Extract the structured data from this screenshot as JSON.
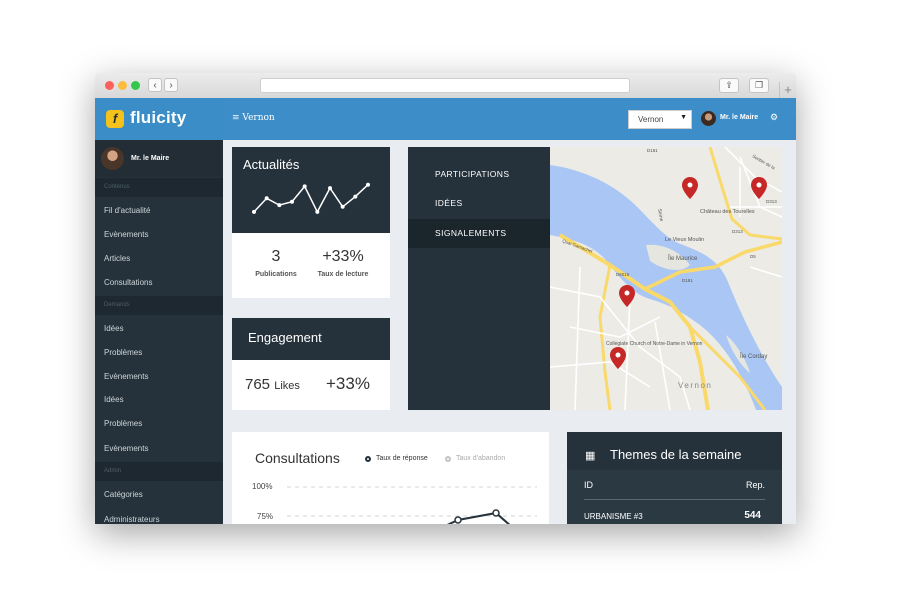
{
  "header": {
    "logo_text": "fluicity",
    "menu_label": "≡ Vernon",
    "city_select_value": "Vernon",
    "user_name": "Mr. le Maire"
  },
  "sidebar": {
    "profile_name": "Mr. le Maire",
    "sections": [
      {
        "title": "Contenus",
        "items": [
          "Fil d'actualité",
          "Evènements",
          "Articles",
          "Consultations"
        ]
      },
      {
        "title": "Demands",
        "items": [
          "Idées",
          "Problèmes",
          "Evènements",
          "Idées",
          "Problèmes",
          "Evènements"
        ]
      },
      {
        "title": "Admin",
        "items": [
          "Catégories",
          "Administrateurs"
        ]
      }
    ]
  },
  "actualites": {
    "title": "Actualités",
    "stats": [
      {
        "value": "3",
        "label": "Publications"
      },
      {
        "value": "+33%",
        "label": "Taux de lecture"
      }
    ],
    "sparkline": [
      0.15,
      0.55,
      0.35,
      0.45,
      0.9,
      0.15,
      0.85,
      0.3,
      0.6,
      0.95
    ]
  },
  "engagement": {
    "title": "Engagement",
    "likes_value": "765",
    "likes_unit": "Likes",
    "rate": "+33%"
  },
  "map_panel": {
    "menu": [
      "PARTICIPATIONS",
      "IDÉES",
      "SIGNALEMENTS"
    ],
    "active": "SIGNALEMENTS",
    "place_labels": [
      "Château des Tourelles",
      "Le Vieux Moulin",
      "Île Maurice",
      "Île Corday",
      "Collegiate Church of Notre-Dame in Vernon",
      "Vernon",
      "Quai Garnachet",
      "Seine",
      "D181",
      "D313",
      "D5",
      "D6015",
      "D181",
      "D313",
      "Sentier de la"
    ]
  },
  "consultations": {
    "title": "Consultations",
    "legend": [
      "Taux de réponse",
      "Taux d'abandon"
    ],
    "y_ticks": [
      "100%",
      "75%"
    ]
  },
  "themes": {
    "title": "Themes de la semaine",
    "col_id": "ID",
    "col_rep": "Rep.",
    "rows": [
      {
        "id": "URBANISME #3",
        "rep": "544"
      }
    ]
  },
  "colors": {
    "header_blue": "#3d8ec8",
    "sidebar_dark": "#25323b",
    "accent_yellow": "#f4c21c",
    "pin_red": "#c62828",
    "water_blue": "#a9c6f5"
  }
}
